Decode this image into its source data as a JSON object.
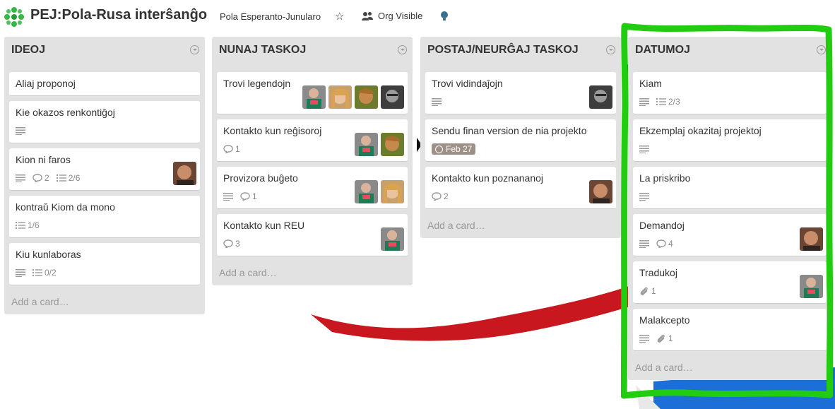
{
  "board": {
    "title": "PEJ:Pola-Rusa interŝanĝo",
    "org_name": "Pola Esperanto-Junularo",
    "visibility": "Org Visible"
  },
  "icons": {
    "logo": "clover-logo-icon",
    "star": "star-icon",
    "visibility": "people-icon",
    "bulb": "lightbulb-icon",
    "description": "description-lines-icon",
    "comments": "comment-bubble-icon",
    "checklist": "checklist-icon",
    "attachment": "paperclip-icon",
    "due": "clock-icon"
  },
  "colors": {
    "list_bg": "#e2e2e2",
    "card_bg": "#ffffff",
    "annotation": "#22cc11",
    "date_badge": "#9e9087"
  },
  "lists": [
    {
      "title": "IDEOJ",
      "add_card": "Add a card…",
      "cards": [
        {
          "title": "Aliaj proponoj",
          "desc": false,
          "comments": "",
          "checklist": "",
          "attachments": "",
          "due": "",
          "members": []
        },
        {
          "title": "Kie okazos renkontiĝoj",
          "desc": true,
          "comments": "",
          "checklist": "",
          "attachments": "",
          "due": "",
          "members": []
        },
        {
          "title": "Kion ni faros",
          "desc": true,
          "comments": "2",
          "checklist": "2/6",
          "attachments": "",
          "due": "",
          "members": [
            "m1"
          ]
        },
        {
          "title": "kontraŭ Kiom da mono",
          "desc": false,
          "comments": "",
          "checklist": "1/6",
          "attachments": "",
          "due": "",
          "members": []
        },
        {
          "title": "Kiu kunlaboras",
          "desc": true,
          "comments": "",
          "checklist": "0/2",
          "attachments": "",
          "due": "",
          "members": []
        }
      ]
    },
    {
      "title": "NUNAJ TASKOJ",
      "add_card": "Add a card…",
      "cards": [
        {
          "title": "Trovi legendojn",
          "desc": false,
          "comments": "",
          "checklist": "",
          "attachments": "",
          "due": "",
          "members": [
            "m2",
            "m3",
            "m4",
            "m5"
          ]
        },
        {
          "title": "Kontakto kun reĝisoroj",
          "desc": false,
          "comments": "1",
          "checklist": "",
          "attachments": "",
          "due": "",
          "members": [
            "m2",
            "m4"
          ]
        },
        {
          "title": "Provizora buĝeto",
          "desc": true,
          "comments": "1",
          "checklist": "",
          "attachments": "",
          "due": "",
          "members": [
            "m2",
            "m3"
          ]
        },
        {
          "title": "Kontakto kun REU",
          "desc": false,
          "comments": "3",
          "checklist": "",
          "attachments": "",
          "due": "",
          "members": [
            "m2"
          ]
        }
      ]
    },
    {
      "title": "POSTAJ/NEURĜAJ TASKOJ",
      "add_card": "Add a card…",
      "cards": [
        {
          "title": "Trovi vidindaĵojn",
          "desc": true,
          "comments": "",
          "checklist": "",
          "attachments": "",
          "due": "",
          "members": [
            "m5"
          ]
        },
        {
          "title": "Sendu finan version de nia projekto",
          "desc": false,
          "comments": "",
          "checklist": "",
          "attachments": "",
          "due": "Feb 27",
          "members": []
        },
        {
          "title": "Kontakto kun poznananoj",
          "desc": false,
          "comments": "2",
          "checklist": "",
          "attachments": "",
          "due": "",
          "members": [
            "m1"
          ]
        }
      ]
    },
    {
      "title": "DATUMOJ",
      "add_card": "Add a card…",
      "cards": [
        {
          "title": "Kiam",
          "desc": true,
          "comments": "",
          "checklist": "2/3",
          "attachments": "",
          "due": "",
          "members": []
        },
        {
          "title": "Ekzemplaj okazitaj projektoj",
          "desc": true,
          "comments": "",
          "checklist": "",
          "attachments": "",
          "due": "",
          "members": []
        },
        {
          "title": "La priskribo",
          "desc": true,
          "comments": "",
          "checklist": "",
          "attachments": "",
          "due": "",
          "members": []
        },
        {
          "title": "Demandoj",
          "desc": true,
          "comments": "4",
          "checklist": "",
          "attachments": "",
          "due": "",
          "members": [
            "m1"
          ]
        },
        {
          "title": "Tradukoj",
          "desc": false,
          "comments": "",
          "checklist": "",
          "attachments": "1",
          "due": "",
          "members": [
            "m2"
          ]
        },
        {
          "title": "Malakcepto",
          "desc": true,
          "comments": "",
          "checklist": "",
          "attachments": "1",
          "due": "",
          "members": []
        }
      ]
    }
  ]
}
